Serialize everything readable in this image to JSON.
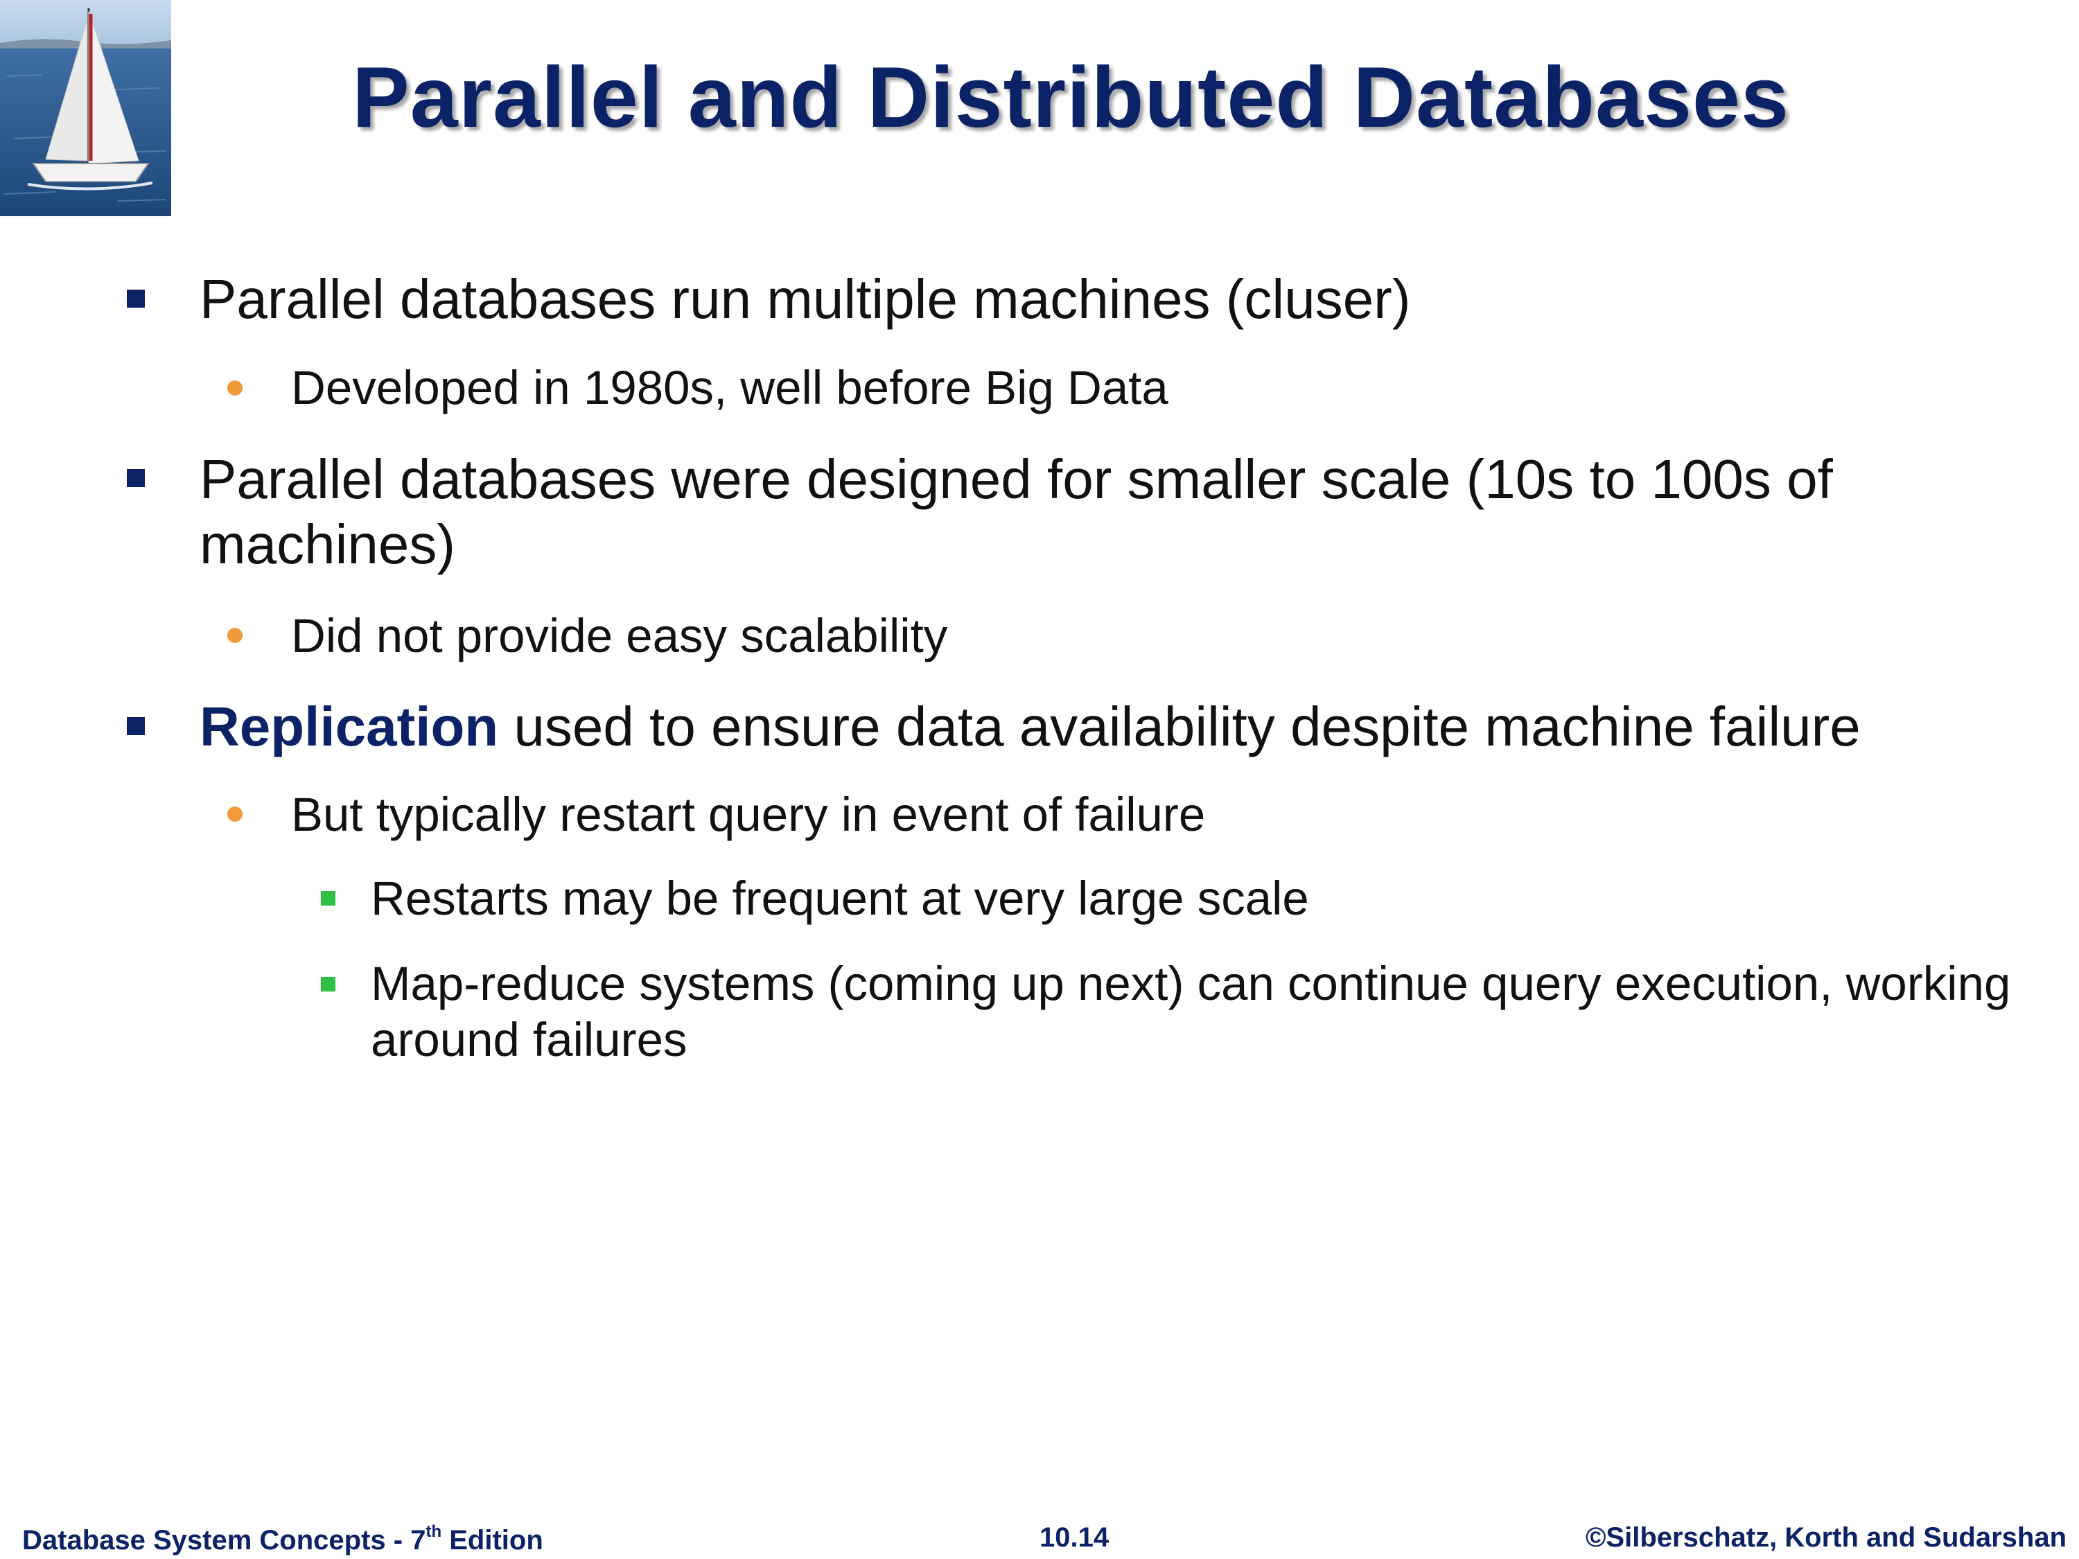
{
  "slide": {
    "title": "Parallel and Distributed Databases"
  },
  "bullets": {
    "b1": "Parallel databases run multiple machines  (cluser)",
    "b1_1": "Developed in 1980s, well before Big Data",
    "b2": "Parallel databases were designed for smaller scale (10s to 100s of machines)",
    "b2_1": "Did not provide easy scalability",
    "b3_em": "Replication",
    "b3_rest": " used to ensure data availability despite machine failure",
    "b3_1": "But typically restart query in event of failure",
    "b3_1_1": "Restarts may be frequent at very large scale",
    "b3_1_2": "Map-reduce systems (coming up next) can continue query execution, working around failures"
  },
  "footer": {
    "left_prefix": "Database System Concepts - 7",
    "left_sup": "th",
    "left_suffix": " Edition",
    "page": "10.14",
    "right": "©Silberschatz, Korth and Sudarshan"
  },
  "colors": {
    "title": "#0c2266",
    "bullet_level1": "#0c2266",
    "bullet_level2": "#f29a3a",
    "bullet_level3": "#2fc144",
    "emphasis": "#0c2266"
  },
  "icons": {
    "logo": "sailboat-photo"
  }
}
